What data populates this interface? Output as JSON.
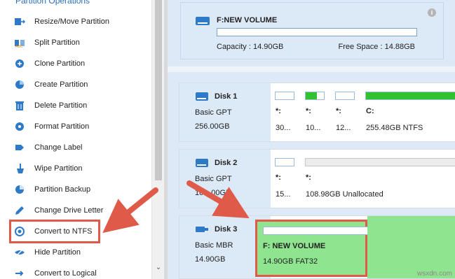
{
  "sidebar": {
    "title": "Partition Operations",
    "items": [
      {
        "label": "Resize/Move Partition",
        "icon": "resize-icon"
      },
      {
        "label": "Split Partition",
        "icon": "split-icon"
      },
      {
        "label": "Clone Partition",
        "icon": "clone-icon"
      },
      {
        "label": "Create Partition",
        "icon": "create-icon"
      },
      {
        "label": "Delete Partition",
        "icon": "delete-icon"
      },
      {
        "label": "Format Partition",
        "icon": "format-icon"
      },
      {
        "label": "Change Label",
        "icon": "label-icon"
      },
      {
        "label": "Wipe Partition",
        "icon": "wipe-icon"
      },
      {
        "label": "Partition Backup",
        "icon": "backup-icon"
      },
      {
        "label": "Change Drive Letter",
        "icon": "drive-letter-icon"
      },
      {
        "label": "Convert to NTFS",
        "icon": "convert-icon"
      },
      {
        "label": "Hide Partition",
        "icon": "hide-icon"
      },
      {
        "label": "Convert to Logical",
        "icon": "logical-icon"
      }
    ]
  },
  "volume": {
    "name": "F:NEW VOLUME",
    "capacity": "Capacity : 14.90GB",
    "free": "Free Space : 14.88GB",
    "used_fraction": 0.0
  },
  "disks": [
    {
      "name": "Disk 1",
      "type": "Basic GPT",
      "size": "256.00GB",
      "partitions": [
        {
          "letter": "*:",
          "detail": "30...",
          "used_fraction": 0.0
        },
        {
          "letter": "*:",
          "detail": "10...",
          "used_fraction": 0.6
        },
        {
          "letter": "*:",
          "detail": "12...",
          "used_fraction": 0.0
        },
        {
          "letter": "C:",
          "detail": "255.48GB NTFS",
          "used_fraction": 1.0
        }
      ]
    },
    {
      "name": "Disk 2",
      "type": "Basic GPT",
      "size": "10…00GB",
      "partitions": [
        {
          "letter": "*:",
          "detail": "15...",
          "used_fraction": 0.0
        },
        {
          "letter": "*:",
          "detail": "108.98GB Unallocated",
          "used_fraction": 0.0
        }
      ]
    },
    {
      "name": "Disk 3",
      "type": "Basic MBR",
      "size": "14.90GB",
      "partitions": [
        {
          "letter": "F: NEW VOLUME",
          "detail": "14.90GB FAT32",
          "used_fraction": 0.0
        }
      ]
    }
  ],
  "colors": {
    "accent": "#2b6fb8",
    "used": "#31c231",
    "highlight": "#e05a4a",
    "selected_partition": "#8fe58f"
  },
  "watermark": "wsxdn.com"
}
